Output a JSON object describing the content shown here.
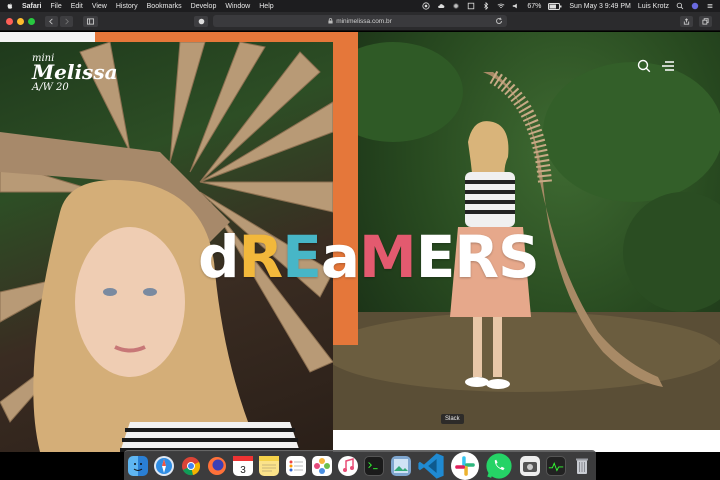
{
  "menubar": {
    "apple_icon": "apple-icon",
    "items": [
      "Safari",
      "File",
      "Edit",
      "View",
      "History",
      "Bookmarks",
      "Develop",
      "Window",
      "Help"
    ],
    "battery": "67%",
    "datetime": "Sun May 3  9:49 PM",
    "user": "Luis Krotz"
  },
  "browser": {
    "url": "minimelissa.com.br"
  },
  "site": {
    "brand_line1": "mini",
    "brand_line2": "Melissa",
    "brand_line3": "A/W 20",
    "headline_letters": [
      {
        "ch": "d",
        "color": "#ffffff"
      },
      {
        "ch": "R",
        "color": "#f2b83b"
      },
      {
        "ch": "E",
        "color": "#47b6c7"
      },
      {
        "ch": "a",
        "color": "#ffffff"
      },
      {
        "ch": "M",
        "color": "#e35a6f"
      },
      {
        "ch": "E",
        "color": "#ffffff"
      },
      {
        "ch": "R",
        "color": "#ffffff"
      },
      {
        "ch": "S",
        "color": "#ffffff"
      }
    ]
  },
  "tooltip": "Slack",
  "dock": [
    "Finder",
    "Safari",
    "Chrome",
    "Firefox",
    "Calendar",
    "Notes",
    "Reminders",
    "Photos",
    "Music",
    "Terminal",
    "Preview",
    "VS Code",
    "Slack",
    "WhatsApp",
    "Screenshot",
    "Activity Monitor",
    "Trash"
  ]
}
